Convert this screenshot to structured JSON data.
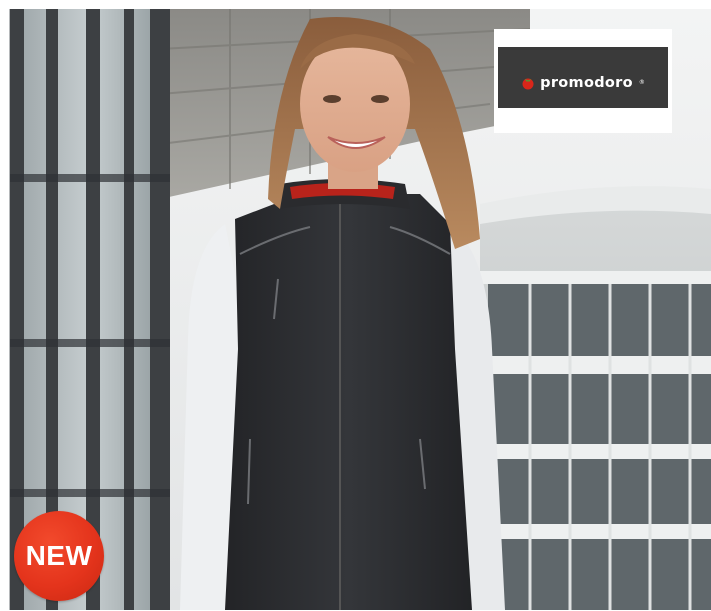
{
  "brand": {
    "name": "promodoro",
    "registered_mark": "®",
    "logo_icon": "tomato-icon",
    "logo_box_color": "#3a3a3a"
  },
  "badge": {
    "label": "NEW",
    "color": "#e4341c"
  },
  "photo": {
    "icon": "product-photo-image"
  }
}
